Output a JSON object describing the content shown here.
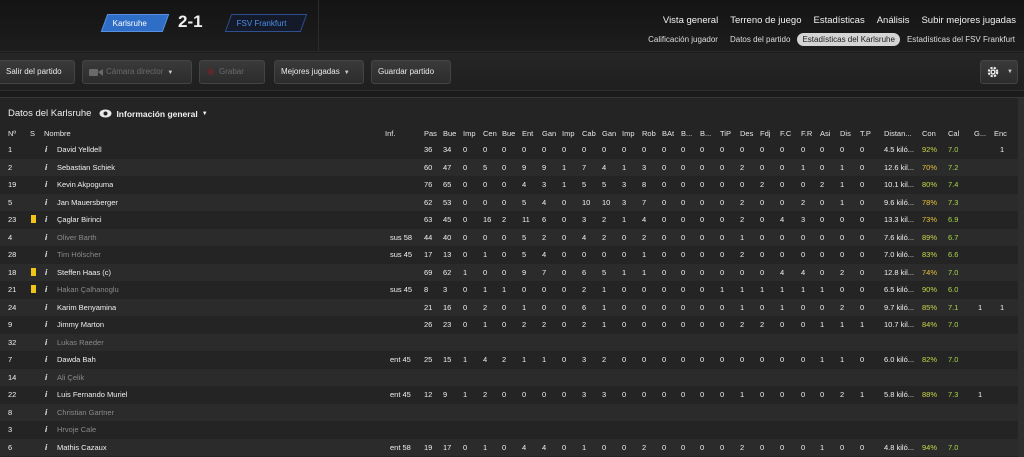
{
  "header": {
    "home_team": "Karlsruhe",
    "away_team": "FSV Frankfurt",
    "score": "2-1",
    "main_nav": [
      "Vista general",
      "Terreno de juego",
      "Estadísticas",
      "Análisis",
      "Subir mejores jugadas"
    ],
    "sub_nav": [
      "Calificación jugador",
      "Datos del partido",
      "Estadísticas del Karlsruhe",
      "Estadísticas del FSV Frankfurt"
    ],
    "active_sub_nav": "Estadísticas del Karlsruhe"
  },
  "toolbar": {
    "exit_label": "Salir del partido",
    "camera_label": "Cámara director",
    "record_label": "Grabar",
    "highlights_label": "Mejores jugadas",
    "save_label": "Guardar partido"
  },
  "panel": {
    "title": "Datos del Karlsruhe",
    "view_label": "Información general"
  },
  "columns": [
    "Nº",
    "S",
    "Nombre",
    "Inf.",
    "Pas",
    "Bue",
    "Imp",
    "Cen",
    "Bue",
    "Ent",
    "Gan",
    "Imp",
    "Cab",
    "Gan",
    "Imp",
    "Rob",
    "BAt",
    "B...",
    "B...",
    "TiP",
    "Des",
    "Fdj",
    "F.C",
    "F.R",
    "Asi",
    "Dis",
    "T.P",
    "Distan...",
    "Con",
    "Cal",
    "G...",
    "Enc"
  ],
  "rows": [
    {
      "num": "1",
      "card": false,
      "sub": false,
      "name": "David Yelldell",
      "inf": "",
      "stats": [
        "36",
        "34",
        "0",
        "0",
        "0",
        "0",
        "0",
        "0",
        "0",
        "0",
        "0",
        "0",
        "0",
        "0",
        "0",
        "0",
        "0",
        "0",
        "0",
        "0",
        "0",
        "0",
        "0"
      ],
      "dist": "4.5 kiló...",
      "con": "92%",
      "cal": "7.0",
      "g": "",
      "enc": "1"
    },
    {
      "num": "2",
      "card": false,
      "sub": false,
      "name": "Sebastian Schiek",
      "inf": "",
      "stats": [
        "60",
        "47",
        "0",
        "5",
        "0",
        "9",
        "9",
        "1",
        "7",
        "4",
        "1",
        "3",
        "0",
        "0",
        "0",
        "0",
        "2",
        "0",
        "0",
        "1",
        "0",
        "1",
        "0"
      ],
      "dist": "12.6 kil...",
      "con": "70%",
      "cal": "7.2",
      "g": "",
      "enc": ""
    },
    {
      "num": "19",
      "card": false,
      "sub": false,
      "name": "Kevin Akpoguma",
      "inf": "",
      "stats": [
        "76",
        "65",
        "0",
        "0",
        "0",
        "4",
        "3",
        "1",
        "5",
        "5",
        "3",
        "8",
        "0",
        "0",
        "0",
        "0",
        "0",
        "2",
        "0",
        "0",
        "2",
        "1",
        "0"
      ],
      "dist": "10.1 kil...",
      "con": "80%",
      "cal": "7.4",
      "g": "",
      "enc": ""
    },
    {
      "num": "5",
      "card": false,
      "sub": false,
      "name": "Jan Mauersberger",
      "inf": "",
      "stats": [
        "62",
        "53",
        "0",
        "0",
        "0",
        "5",
        "4",
        "0",
        "10",
        "10",
        "3",
        "7",
        "0",
        "0",
        "0",
        "0",
        "2",
        "0",
        "0",
        "2",
        "0",
        "1",
        "0"
      ],
      "dist": "9.6 kiló...",
      "con": "78%",
      "cal": "7.3",
      "g": "",
      "enc": ""
    },
    {
      "num": "23",
      "card": true,
      "sub": false,
      "name": "Çaglar Birinci",
      "inf": "",
      "stats": [
        "63",
        "45",
        "0",
        "16",
        "2",
        "11",
        "6",
        "0",
        "3",
        "2",
        "1",
        "4",
        "0",
        "0",
        "0",
        "0",
        "2",
        "0",
        "4",
        "3",
        "0",
        "0",
        "0"
      ],
      "dist": "13.3 kil...",
      "con": "73%",
      "cal": "6.9",
      "g": "",
      "enc": ""
    },
    {
      "num": "4",
      "card": false,
      "sub": true,
      "name": "Oliver Barth",
      "inf": "sus 58",
      "stats": [
        "44",
        "40",
        "0",
        "0",
        "0",
        "5",
        "2",
        "0",
        "4",
        "2",
        "0",
        "2",
        "0",
        "0",
        "0",
        "0",
        "1",
        "0",
        "0",
        "0",
        "0",
        "0",
        "0"
      ],
      "dist": "7.6 kiló...",
      "con": "89%",
      "cal": "6.7",
      "g": "",
      "enc": ""
    },
    {
      "num": "28",
      "card": false,
      "sub": true,
      "name": "Tim Hölscher",
      "inf": "sus 45",
      "stats": [
        "17",
        "13",
        "0",
        "1",
        "0",
        "5",
        "4",
        "0",
        "0",
        "0",
        "0",
        "1",
        "0",
        "0",
        "0",
        "0",
        "2",
        "0",
        "0",
        "0",
        "0",
        "0",
        "0"
      ],
      "dist": "7.0 kiló...",
      "con": "83%",
      "cal": "6.6",
      "g": "",
      "enc": ""
    },
    {
      "num": "18",
      "card": true,
      "sub": false,
      "name": "Steffen Haas (c)",
      "inf": "",
      "stats": [
        "69",
        "62",
        "1",
        "0",
        "0",
        "9",
        "7",
        "0",
        "6",
        "5",
        "1",
        "1",
        "0",
        "0",
        "0",
        "0",
        "0",
        "0",
        "4",
        "4",
        "0",
        "2",
        "0"
      ],
      "dist": "12.8 kil...",
      "con": "74%",
      "cal": "7.0",
      "g": "",
      "enc": ""
    },
    {
      "num": "21",
      "card": true,
      "sub": true,
      "name": "Hakan Çalhanoglu",
      "inf": "sus 45",
      "stats": [
        "8",
        "3",
        "0",
        "1",
        "1",
        "0",
        "0",
        "0",
        "2",
        "1",
        "0",
        "0",
        "0",
        "0",
        "0",
        "1",
        "1",
        "1",
        "1",
        "1",
        "1",
        "0",
        "0"
      ],
      "dist": "6.5 kiló...",
      "con": "90%",
      "cal": "6.0",
      "g": "",
      "enc": ""
    },
    {
      "num": "24",
      "card": false,
      "sub": false,
      "name": "Karim Benyamina",
      "inf": "",
      "stats": [
        "21",
        "16",
        "0",
        "2",
        "0",
        "1",
        "0",
        "0",
        "6",
        "1",
        "0",
        "0",
        "0",
        "0",
        "0",
        "0",
        "1",
        "0",
        "1",
        "0",
        "0",
        "2",
        "0"
      ],
      "dist": "9.7 kiló...",
      "con": "85%",
      "cal": "7.1",
      "g": "1",
      "enc": "1"
    },
    {
      "num": "9",
      "card": false,
      "sub": false,
      "name": "Jimmy Marton",
      "inf": "",
      "stats": [
        "26",
        "23",
        "0",
        "1",
        "0",
        "2",
        "2",
        "0",
        "2",
        "1",
        "0",
        "0",
        "0",
        "0",
        "0",
        "0",
        "2",
        "2",
        "0",
        "0",
        "1",
        "1",
        "1"
      ],
      "dist": "10.7 kil...",
      "con": "84%",
      "cal": "7.0",
      "g": "",
      "enc": ""
    },
    {
      "num": "32",
      "card": false,
      "sub": true,
      "name": "Lukas Raeder",
      "inf": "",
      "stats": [
        "",
        "",
        "",
        "",
        "",
        "",
        "",
        "",
        "",
        "",
        "",
        "",
        "",
        "",
        "",
        "",
        "",
        "",
        "",
        "",
        "",
        "",
        ""
      ],
      "dist": "",
      "con": "",
      "cal": "",
      "g": "",
      "enc": ""
    },
    {
      "num": "7",
      "card": false,
      "sub": false,
      "name": "Dawda Bah",
      "inf": "ent 45",
      "stats": [
        "25",
        "15",
        "1",
        "4",
        "2",
        "1",
        "1",
        "0",
        "3",
        "2",
        "0",
        "0",
        "0",
        "0",
        "0",
        "0",
        "0",
        "0",
        "0",
        "0",
        "1",
        "1",
        "0"
      ],
      "dist": "6.0 kiló...",
      "con": "82%",
      "cal": "7.0",
      "g": "",
      "enc": ""
    },
    {
      "num": "14",
      "card": false,
      "sub": true,
      "name": "Ali Çelik",
      "inf": "",
      "stats": [
        "",
        "",
        "",
        "",
        "",
        "",
        "",
        "",
        "",
        "",
        "",
        "",
        "",
        "",
        "",
        "",
        "",
        "",
        "",
        "",
        "",
        "",
        ""
      ],
      "dist": "",
      "con": "",
      "cal": "",
      "g": "",
      "enc": ""
    },
    {
      "num": "22",
      "card": false,
      "sub": false,
      "name": "Luis Fernando Muriel",
      "inf": "ent 45",
      "stats": [
        "12",
        "9",
        "1",
        "2",
        "0",
        "0",
        "0",
        "0",
        "3",
        "3",
        "0",
        "0",
        "0",
        "0",
        "0",
        "0",
        "1",
        "0",
        "0",
        "0",
        "0",
        "2",
        "1"
      ],
      "dist": "5.8 kiló...",
      "con": "88%",
      "cal": "7.3",
      "g": "1",
      "enc": ""
    },
    {
      "num": "8",
      "card": false,
      "sub": true,
      "name": "Christian Gartner",
      "inf": "",
      "stats": [
        "",
        "",
        "",
        "",
        "",
        "",
        "",
        "",
        "",
        "",
        "",
        "",
        "",
        "",
        "",
        "",
        "",
        "",
        "",
        "",
        "",
        "",
        ""
      ],
      "dist": "",
      "con": "",
      "cal": "",
      "g": "",
      "enc": ""
    },
    {
      "num": "3",
      "card": false,
      "sub": true,
      "name": "Hrvoje Cale",
      "inf": "",
      "stats": [
        "",
        "",
        "",
        "",
        "",
        "",
        "",
        "",
        "",
        "",
        "",
        "",
        "",
        "",
        "",
        "",
        "",
        "",
        "",
        "",
        "",
        "",
        ""
      ],
      "dist": "",
      "con": "",
      "cal": "",
      "g": "",
      "enc": ""
    },
    {
      "num": "6",
      "card": false,
      "sub": false,
      "name": "Mathis Cazaux",
      "inf": "ent 58",
      "stats": [
        "19",
        "17",
        "0",
        "1",
        "0",
        "4",
        "4",
        "0",
        "1",
        "0",
        "0",
        "2",
        "0",
        "0",
        "0",
        "0",
        "2",
        "0",
        "0",
        "0",
        "1",
        "0",
        "0"
      ],
      "dist": "4.8 kiló...",
      "con": "94%",
      "cal": "7.0",
      "g": "",
      "enc": ""
    }
  ]
}
